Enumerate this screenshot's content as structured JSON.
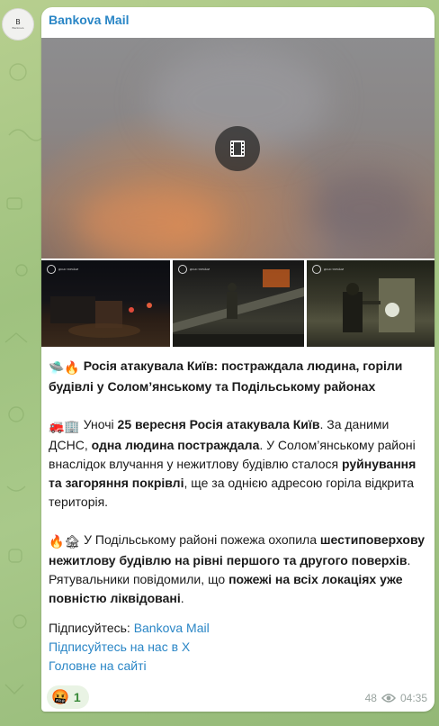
{
  "channel": {
    "avatar_text": "Bankova",
    "sender_name": "Bankova Mail"
  },
  "media": {
    "video_icon": "video-play-icon",
    "thumb_watermark": "ДСНС УКРАЇНИ"
  },
  "post": {
    "headline_emoji": "🛸🔥",
    "headline": "Росія атакувала Київ: постраждала людина, горіли будівлі у Солом’янському та Подільському районах",
    "p1_emoji": "🚒🏢",
    "p1_a": "Уночі ",
    "p1_b": "25 вересня Росія атакувала Київ",
    "p1_c": ". За даними ДСНС, ",
    "p1_d": "одна людина постраждала",
    "p1_e": ". У Солом’янському районі внаслідок влучання у нежитлову будівлю сталося ",
    "p1_f": "руйнування та загоряння покрівлі",
    "p1_g": ", ще за однією адресою горіла відкрита територія.",
    "p2_emoji": "🔥🏚",
    "p2_a": "У Подільському районі пожежа охопила ",
    "p2_b": "шестиповерхову нежитлову будівлю на рівні першого та другого поверхів",
    "p2_c": ". Рятувальники повідомили, що ",
    "p2_d": "пожежі на всіх локаціях уже повністю ліквідовані",
    "p2_e": "."
  },
  "footer_links": {
    "subscribe_prefix": "Підписуйтесь: ",
    "subscribe_link": "Bankova Mail",
    "x_link": "Підписуйтесь на нас в Х",
    "site_link": "Головне на сайті"
  },
  "reaction": {
    "emoji": "🤬",
    "count": "1"
  },
  "meta": {
    "views": "48",
    "time": "04:35",
    "views_icon": "eye-icon"
  },
  "colors": {
    "link": "#2a86c6",
    "bubble": "#ffffff",
    "wallpaper": "#a9c98a"
  }
}
